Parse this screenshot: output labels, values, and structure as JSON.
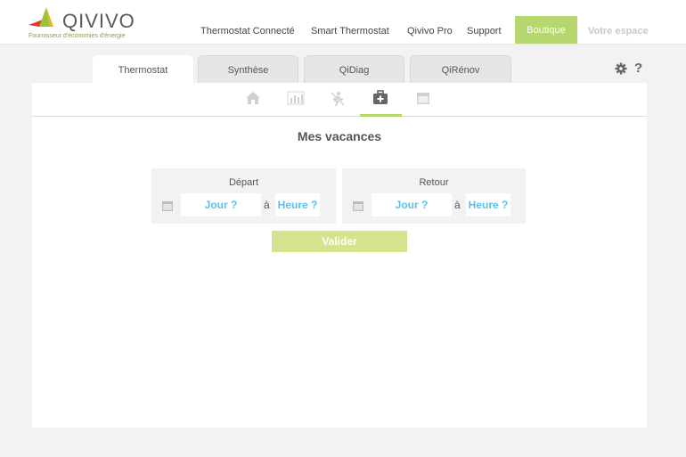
{
  "brand": {
    "name": "QIVIVO",
    "tagline": "Fournisseur d'économies d'énergie"
  },
  "nav": {
    "items": [
      "Thermostat Connecté",
      "Smart Thermostat",
      "Qivivo Pro",
      "Support"
    ],
    "shop": "Boutique",
    "account": "Votre espace"
  },
  "tabs": [
    "Thermostat",
    "Synthèse",
    "QiDiag",
    "QiRénov"
  ],
  "toolbar": {
    "help": "?"
  },
  "colors": {
    "accent": "#b6d66e",
    "link": "#5bc0e8"
  },
  "subnav": {
    "icons": [
      "home-icon",
      "chart-icon",
      "away-icon",
      "suitcase-icon",
      "calendar-icon"
    ],
    "active_index": 3
  },
  "vacation": {
    "title": "Mes vacances",
    "departure": {
      "label": "Départ",
      "day": "Jour ?",
      "sep": "à",
      "hour": "Heure ?"
    },
    "return": {
      "label": "Retour",
      "day": "Jour ?",
      "sep": "à",
      "hour": "Heure ?"
    },
    "submit": "Valider"
  }
}
